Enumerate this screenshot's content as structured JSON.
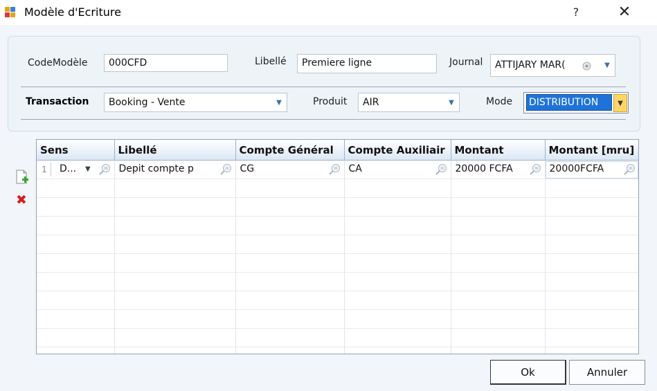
{
  "window": {
    "title": "Modèle d'Ecriture",
    "help_label": "?",
    "close_label": "✕"
  },
  "form": {
    "code_label": "CodeModèle",
    "code_value": "000CFD",
    "libelle_label": "Libellé",
    "libelle_value": "Premiere ligne",
    "journal_label": "Journal",
    "journal_value": "ATTIJARY MAR(",
    "transaction_label": "Transaction",
    "transaction_value": "Booking - Vente",
    "produit_label": "Produit",
    "produit_value": "AIR",
    "mode_label": "Mode",
    "mode_value": "DISTRIBUTION"
  },
  "grid": {
    "columns": [
      "Sens",
      "Libellé",
      "Compte Général",
      "Compte Auxiliair",
      "Montant",
      "Montant [mru]"
    ],
    "rows": [
      {
        "num": "1",
        "sens": "D...",
        "libelle": "Depit compte p",
        "compte_general": "CG",
        "compte_auxiliaire": "CA",
        "montant": "20000 FCFA",
        "montant_mru": "20000FCFA"
      }
    ]
  },
  "buttons": {
    "ok": "Ok",
    "cancel": "Annuler"
  },
  "icons": {
    "app": "app-icon",
    "add_row": "add-document-icon",
    "delete_row": "delete-icon",
    "lookup": "search-icon",
    "dropdown": "chevron-down-icon"
  },
  "colors": {
    "accent": "#1e73d8",
    "header_gradient_end": "#dbe7f5",
    "mode_arrow": "#ffd666",
    "delete": "#d42020"
  }
}
